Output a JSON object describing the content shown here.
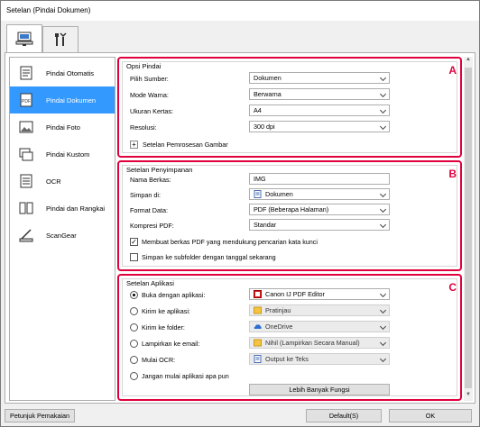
{
  "window": {
    "title": "Setelan (Pindai Dokumen)"
  },
  "tabs": [
    {
      "icon": "scan-from-computer-icon"
    },
    {
      "icon": "general-settings-tools-icon"
    }
  ],
  "sidebar": {
    "items": [
      {
        "label": "Pindai Otomatis",
        "icon": "auto-scan-icon"
      },
      {
        "label": "Pindai Dokumen",
        "icon": "document-scan-icon",
        "selected": true
      },
      {
        "label": "Pindai Foto",
        "icon": "photo-scan-icon"
      },
      {
        "label": "Pindai Kustom",
        "icon": "custom-scan-icon"
      },
      {
        "label": "OCR",
        "icon": "ocr-icon"
      },
      {
        "label": "Pindai dan Rangkai",
        "icon": "scan-and-stitch-icon"
      },
      {
        "label": "ScanGear",
        "icon": "scangear-icon"
      }
    ]
  },
  "scan_options": {
    "title": "Opsi Pindai",
    "badge": "A",
    "source": {
      "label": "Pilih Sumber:",
      "value": "Dokumen"
    },
    "color_mode": {
      "label": "Mode Warna:",
      "value": "Berwarna"
    },
    "paper_size": {
      "label": "Ukuran Kertas:",
      "value": "A4"
    },
    "resolution": {
      "label": "Resolusi:",
      "value": "300 dpi"
    },
    "image_processing": {
      "label": "Setelan Pemrosesan Gambar"
    }
  },
  "save_settings": {
    "title": "Setelan Penyimpanan",
    "badge": "B",
    "file_name": {
      "label": "Nama Berkas:",
      "value": "IMG"
    },
    "save_in": {
      "label": "Simpan di:",
      "value": "Dokumen"
    },
    "data_format": {
      "label": "Format Data:",
      "value": "PDF (Beberapa Halaman)"
    },
    "pdf_compression": {
      "label": "Kompresi PDF:",
      "value": "Standar"
    },
    "searchable_pdf": {
      "label": "Membuat berkas PDF yang mendukung pencarian kata kunci",
      "checked": true
    },
    "subfolder_date": {
      "label": "Simpan ke subfolder dengan tanggal sekarang",
      "checked": false
    }
  },
  "app_settings": {
    "title": "Setelan Aplikasi",
    "badge": "C",
    "open_with": {
      "label": "Buka dengan aplikasi:",
      "value": "Canon IJ PDF Editor",
      "selected": true
    },
    "send_to_app": {
      "label": "Kirim ke aplikasi:",
      "value": "Pratinjau"
    },
    "send_to_folder": {
      "label": "Kirim ke folder:",
      "value": "OneDrive"
    },
    "attach_email": {
      "label": "Lampirkan ke email:",
      "value": "Nihil (Lampirkan Secara Manual)"
    },
    "start_ocr": {
      "label": "Mulai OCR:",
      "value": "Output ke Teks"
    },
    "no_app": {
      "label": "Jangan mulai aplikasi apa pun"
    },
    "more_functions": "Lebih Banyak Fungsi"
  },
  "footer": {
    "instructions": "Petunjuk Pemakaian",
    "defaults": "Default(S)",
    "ok": "OK"
  }
}
